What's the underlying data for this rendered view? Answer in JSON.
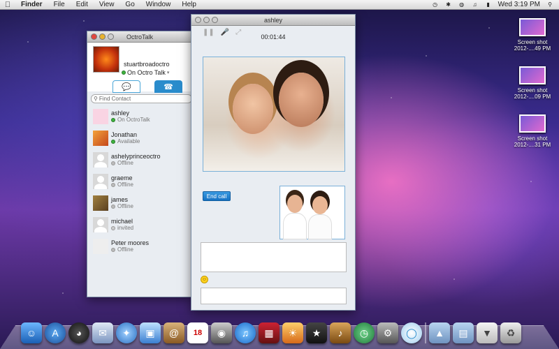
{
  "menubar": {
    "app": "Finder",
    "items": [
      "File",
      "Edit",
      "View",
      "Go",
      "Window",
      "Help"
    ],
    "clock": "Wed 3:19 PM"
  },
  "desktop_icons": [
    {
      "line1": "Screen shot",
      "line2": "2012-....49 PM"
    },
    {
      "line1": "Screen shot",
      "line2": "2012-....09 PM"
    },
    {
      "line1": "Screen shot",
      "line2": "2012-....31 PM"
    }
  ],
  "octrotalk": {
    "title": "OctroTalk",
    "username": "stuartbroadoctro",
    "status": "On Octro Talk",
    "search_placeholder": "Find Contact",
    "contacts": [
      {
        "name": "ashley",
        "status": "On OctroTalk"
      },
      {
        "name": "Jonathan",
        "status": "Available"
      },
      {
        "name": "ashelyprinceoctro",
        "status": "Offline"
      },
      {
        "name": "graeme",
        "status": "Offline"
      },
      {
        "name": "james",
        "status": "Offline"
      },
      {
        "name": "michael",
        "status": "invited"
      },
      {
        "name": "Peter moores",
        "status": "Offline"
      }
    ]
  },
  "call": {
    "title": "ashley",
    "timer": "00:01:44",
    "end_call_label": "End call"
  },
  "dock_icons": [
    "finder-icon",
    "app-store-icon",
    "dashboard-icon",
    "mail-icon",
    "safari-icon",
    "facetime-icon",
    "address-book-icon",
    "ical-icon",
    "photo-booth-icon",
    "itunes-icon",
    "photo-icon",
    "iphoto-icon",
    "imovie-icon",
    "garageband-icon",
    "time-machine-icon",
    "system-preferences-icon",
    "octrotalk-icon",
    "applications-folder-icon",
    "documents-folder-icon",
    "downloads-stack-icon",
    "trash-icon"
  ],
  "colors": {
    "accent": "#2a8ccc",
    "online": "#3eb33e"
  }
}
